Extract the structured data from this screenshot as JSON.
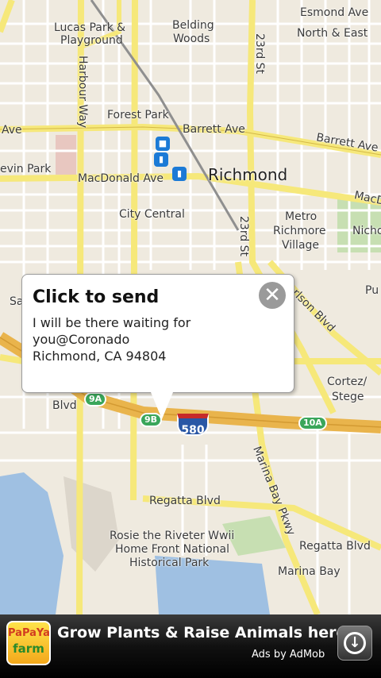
{
  "map": {
    "labels": {
      "esmond_ave": "Esmond Ave",
      "north_east": "North & East",
      "lucas_playground_1": "Lucas Park &",
      "lucas_playground_2": "Playground",
      "belding_woods_1": "Belding",
      "belding_woods_2": "Woods",
      "harbour_way": "Harbour Way",
      "23rd_st_top": "23rd St",
      "forest_park": "Forest Park",
      "barrett_ave_left": "Ave",
      "barrett_ave_mid": "Barrett Ave",
      "barrett_ave_right": "Barrett Ave",
      "nevin_park": "evin Park",
      "macdonald_ave": "MacDonald Ave",
      "richmond": "Richmond",
      "macd_right": "MacD",
      "city_central": "City Central",
      "metro_richmore_1": "Metro",
      "metro_richmore_2": "Richmore",
      "metro_richmore_3": "Village",
      "nicho": "Nicho",
      "23rd_st_mid": "23rd St",
      "sa": "Sa",
      "carlson_blvd": "arlson Blvd",
      "pu": "Pu",
      "cortez_1": "Cortez/",
      "cortez_2": "Stege",
      "blvd_left": "Blvd",
      "marina_bay_pkwy": "Marina Bay Pkwy",
      "regatta_blvd_1": "Regatta Blvd",
      "regatta_blvd_2": "Regatta Blvd",
      "rosie_1": "Rosie the Riveter Wwii",
      "rosie_2": "Home Front National",
      "rosie_3": "Historical Park",
      "marina_bay": "Marina Bay"
    },
    "shields": {
      "exit_9a": "9A",
      "exit_9b": "9B",
      "exit_10a": "10A",
      "i580": "580"
    },
    "transit_icons": [
      "bus-icon",
      "train-icon",
      "train-icon"
    ]
  },
  "bubble": {
    "title": "Click to send",
    "body": "I will be there waiting for\nyou@Coronado\nRichmond, CA 94804"
  },
  "ad": {
    "logo_line1": "PaPaYa",
    "logo_line2": "farm",
    "title": "Grow Plants & Raise Animals here!",
    "attribution": "Ads by AdMob"
  },
  "colors": {
    "map_bg": "#efeadf",
    "street": "#ffffff",
    "arterial": "#f6e87a",
    "freeway": "#e9b44c",
    "water": "#9fc0e2",
    "park": "#c7dfb2"
  }
}
